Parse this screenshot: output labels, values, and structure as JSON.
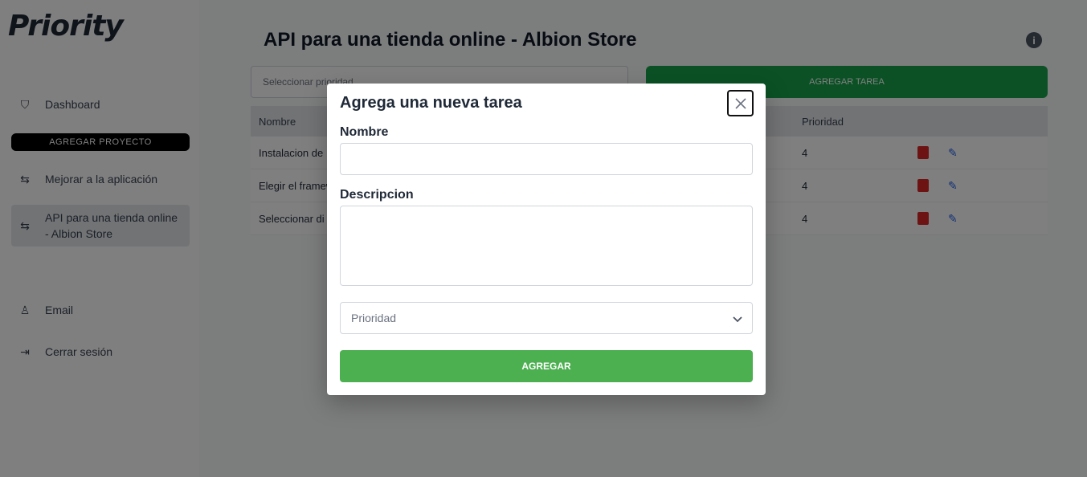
{
  "app": {
    "logo_text": "Priority"
  },
  "sidebar": {
    "items": [
      {
        "label": "Dashboard",
        "icon": "shield-icon"
      },
      {
        "label": "Mejorar a la aplicación",
        "icon": "upgrade-icon"
      },
      {
        "label": "API para una tienda online - Albion Store",
        "icon": "project-icon"
      },
      {
        "label": "Email",
        "icon": "user-icon"
      },
      {
        "label": "Cerrar sesión",
        "icon": "logout-icon"
      }
    ],
    "new_project_label": "Agregar proyecto"
  },
  "main": {
    "title": "API para una tienda online - Albion Store",
    "filter_placeholder": "Seleccionar prioridad",
    "add_task_label": "Agregar tarea",
    "table": {
      "headers": [
        "Nombre",
        "Prioridad"
      ],
      "rows": [
        {
          "name": "Instalacion de",
          "priority": "4"
        },
        {
          "name": "Elegir el framew",
          "priority": "4"
        },
        {
          "name": "Seleccionar di",
          "priority": "4"
        }
      ]
    }
  },
  "modal": {
    "title": "Agrega una nueva tarea",
    "name_label": "Nombre",
    "name_value": "",
    "description_label": "Descripcion",
    "description_value": "",
    "priority_placeholder": "Prioridad",
    "submit_label": "Agregar"
  },
  "colors": {
    "submit_green": "#4caf50",
    "overlay": "rgba(0,0,0,0.5)"
  }
}
